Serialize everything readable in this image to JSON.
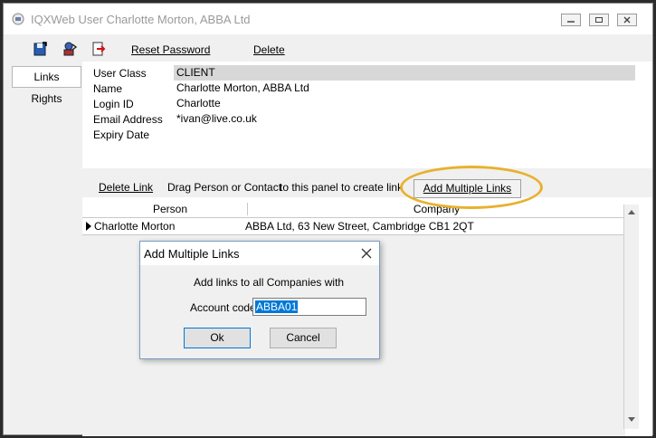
{
  "window": {
    "title": "IQXWeb User Charlotte Morton, ABBA Ltd"
  },
  "toolbar": {
    "reset_password": "Reset Password",
    "delete": "Delete"
  },
  "tabs": [
    {
      "label": "Links"
    },
    {
      "label": "Rights"
    }
  ],
  "details": {
    "rows": [
      {
        "label": "User Class",
        "value": "CLIENT"
      },
      {
        "label": "Name",
        "value": "Charlotte Morton, ABBA Ltd"
      },
      {
        "label": "Login ID",
        "value": "Charlotte"
      },
      {
        "label": "Email Address",
        "value": "*ivan@live.co.uk"
      },
      {
        "label": "Expiry Date",
        "value": ""
      }
    ]
  },
  "link_bar": {
    "delete_link": "Delete Link",
    "drag_text": "Drag Person or Contact",
    "panel_text": "to this panel to create link",
    "add_multiple": "Add Multiple Links"
  },
  "grid": {
    "columns": [
      "Person",
      "Company"
    ],
    "rows": [
      {
        "person": "Charlotte Morton",
        "company": "ABBA Ltd, 63 New Street, Cambridge CB1 2QT"
      }
    ]
  },
  "dialog": {
    "title": "Add Multiple Links",
    "message": "Add links to all Companies with",
    "field_label": "Account code",
    "field_value": "ABBA01",
    "ok": "Ok",
    "cancel": "Cancel"
  },
  "colors": {
    "highlight": "#e8b12e",
    "selection": "#0078d7"
  }
}
